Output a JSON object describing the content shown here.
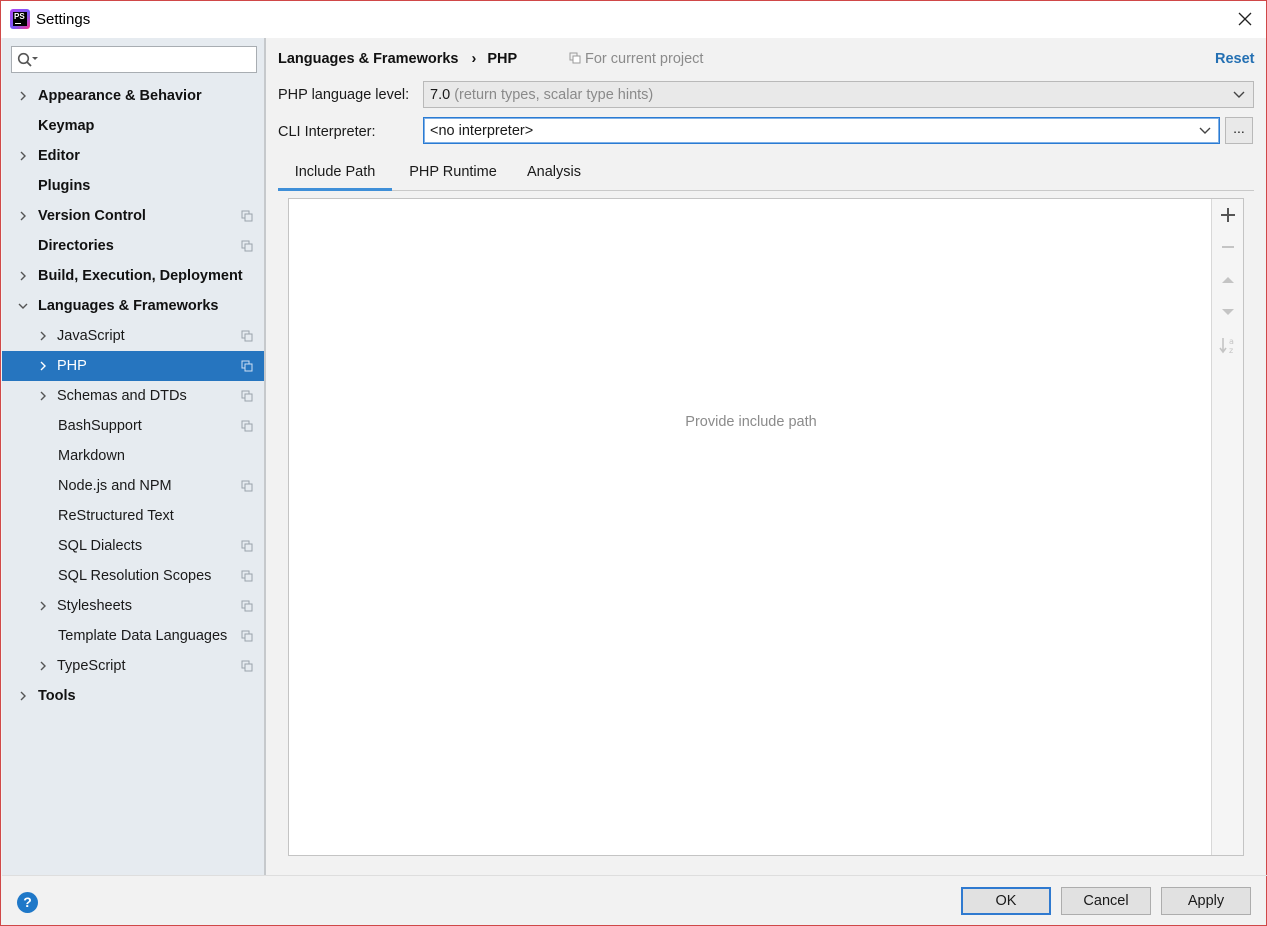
{
  "window": {
    "title": "Settings",
    "app_icon": "phpstorm-icon",
    "close_icon": "close-icon"
  },
  "sidebar": {
    "search": {
      "value": "",
      "placeholder": "",
      "icon": "search-icon"
    },
    "items": [
      {
        "label": "Appearance & Behavior",
        "expandable": true,
        "expanded": false,
        "level": 0,
        "bold": true,
        "project_scoped": false
      },
      {
        "label": "Keymap",
        "expandable": false,
        "level": 0,
        "bold": true,
        "project_scoped": false
      },
      {
        "label": "Editor",
        "expandable": true,
        "expanded": false,
        "level": 0,
        "bold": true,
        "project_scoped": false
      },
      {
        "label": "Plugins",
        "expandable": false,
        "level": 0,
        "bold": true,
        "project_scoped": false
      },
      {
        "label": "Version Control",
        "expandable": true,
        "expanded": false,
        "level": 0,
        "bold": true,
        "project_scoped": true
      },
      {
        "label": "Directories",
        "expandable": false,
        "level": 0,
        "bold": true,
        "project_scoped": true
      },
      {
        "label": "Build, Execution, Deployment",
        "expandable": true,
        "expanded": false,
        "level": 0,
        "bold": true,
        "project_scoped": false
      },
      {
        "label": "Languages & Frameworks",
        "expandable": true,
        "expanded": true,
        "level": 0,
        "bold": true,
        "project_scoped": false
      },
      {
        "label": "JavaScript",
        "expandable": true,
        "expanded": false,
        "level": 1,
        "bold": false,
        "project_scoped": true
      },
      {
        "label": "PHP",
        "expandable": true,
        "expanded": false,
        "level": 1,
        "bold": false,
        "project_scoped": true,
        "selected": true
      },
      {
        "label": "Schemas and DTDs",
        "expandable": true,
        "expanded": false,
        "level": 1,
        "bold": false,
        "project_scoped": true
      },
      {
        "label": "BashSupport",
        "expandable": false,
        "level": 1,
        "bold": false,
        "project_scoped": true
      },
      {
        "label": "Markdown",
        "expandable": false,
        "level": 1,
        "bold": false,
        "project_scoped": false
      },
      {
        "label": "Node.js and NPM",
        "expandable": false,
        "level": 1,
        "bold": false,
        "project_scoped": true
      },
      {
        "label": "ReStructured Text",
        "expandable": false,
        "level": 1,
        "bold": false,
        "project_scoped": false
      },
      {
        "label": "SQL Dialects",
        "expandable": false,
        "level": 1,
        "bold": false,
        "project_scoped": true
      },
      {
        "label": "SQL Resolution Scopes",
        "expandable": false,
        "level": 1,
        "bold": false,
        "project_scoped": true
      },
      {
        "label": "Stylesheets",
        "expandable": true,
        "expanded": false,
        "level": 1,
        "bold": false,
        "project_scoped": true
      },
      {
        "label": "Template Data Languages",
        "expandable": false,
        "level": 1,
        "bold": false,
        "project_scoped": true
      },
      {
        "label": "TypeScript",
        "expandable": true,
        "expanded": false,
        "level": 1,
        "bold": false,
        "project_scoped": true
      },
      {
        "label": "Tools",
        "expandable": true,
        "expanded": false,
        "level": 0,
        "bold": true,
        "project_scoped": false
      }
    ]
  },
  "header": {
    "breadcrumb": [
      "Languages & Frameworks",
      "PHP"
    ],
    "breadcrumb_separator": "›",
    "scope_label": "For current project",
    "reset_label": "Reset"
  },
  "form": {
    "language_level": {
      "label": "PHP language level:",
      "value": "7.0",
      "hint": "(return types, scalar type hints)"
    },
    "cli_interpreter": {
      "label": "CLI Interpreter:",
      "value": "<no interpreter>",
      "browse_label": "..."
    }
  },
  "tabs": [
    {
      "label": "Include Path",
      "active": true
    },
    {
      "label": "PHP Runtime",
      "active": false
    },
    {
      "label": "Analysis",
      "active": false
    }
  ],
  "include_path": {
    "empty_text": "Provide include path",
    "toolbar": [
      "add-icon",
      "remove-icon",
      "move-up-icon",
      "move-down-icon",
      "sort-icon"
    ]
  },
  "footer": {
    "help_label": "?",
    "ok_label": "OK",
    "cancel_label": "Cancel",
    "apply_label": "Apply"
  },
  "colors": {
    "accent": "#2675bf",
    "link": "#2470b3",
    "sidebar_bg": "#e6ebf0",
    "window_border": "#d04848"
  }
}
